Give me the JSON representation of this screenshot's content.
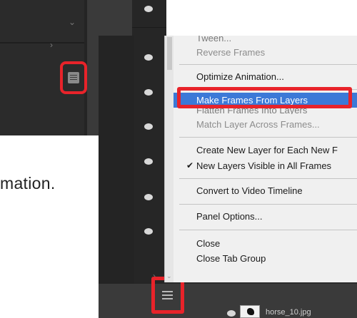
{
  "instruction": {
    "fragment": "mation."
  },
  "menu": {
    "items": [
      {
        "label": "Tween...",
        "state": "disabled"
      },
      {
        "label": "Reverse Frames",
        "state": "disabled"
      },
      {
        "label": "Optimize Animation...",
        "state": "normal"
      },
      {
        "label": "Make Frames From Layers",
        "state": "highlighted"
      },
      {
        "label": "Flatten Frames Into Layers",
        "state": "disabled"
      },
      {
        "label": "Match Layer Across Frames...",
        "state": "disabled"
      },
      {
        "label": "Create New Layer for Each New F",
        "state": "normal"
      },
      {
        "label": "New Layers Visible in All Frames",
        "state": "checked"
      },
      {
        "label": "Convert to Video Timeline",
        "state": "normal"
      },
      {
        "label": "Panel Options...",
        "state": "normal"
      },
      {
        "label": "Close",
        "state": "normal"
      },
      {
        "label": "Close Tab Group",
        "state": "normal"
      }
    ]
  },
  "layers": {
    "layer_name": "horse_10.jpg"
  },
  "colors": {
    "highlight_outline": "#e8232a",
    "menu_selection": "#3c79d7",
    "panel_dark": "#2b2b2b",
    "menu_background": "#f0f0f0"
  },
  "icons": {
    "panel_menu": "hamburger-menu-icon",
    "visibility": "eye-icon",
    "expand": "chevron-icon",
    "checked": "checkmark-icon"
  }
}
